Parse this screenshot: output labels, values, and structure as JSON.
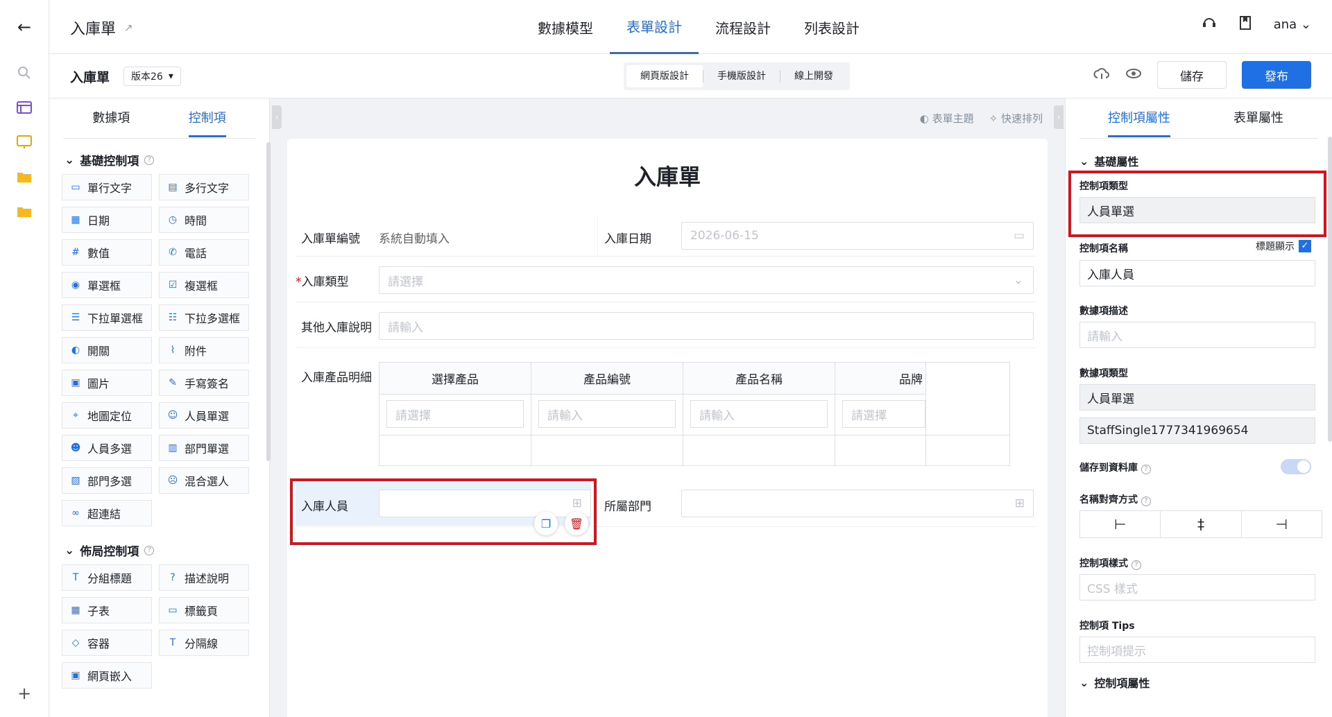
{
  "app": {
    "title": "入庫單"
  },
  "top_tabs": [
    "數據模型",
    "表單設計",
    "流程設計",
    "列表設計"
  ],
  "user": "ana",
  "sub": {
    "title": "入庫單",
    "version": "版本26",
    "modes": [
      "網頁版設計",
      "手機版設計",
      "線上開發"
    ],
    "save": "儲存",
    "publish": "發布"
  },
  "left": {
    "tabs": [
      "數據項",
      "控制項"
    ],
    "basic_title": "基礎控制項",
    "basic": [
      {
        "label": "單行文字",
        "icon": "single-line-icon"
      },
      {
        "label": "多行文字",
        "icon": "multi-line-icon"
      },
      {
        "label": "日期",
        "icon": "calendar-icon"
      },
      {
        "label": "時間",
        "icon": "clock-icon"
      },
      {
        "label": "數值",
        "icon": "number-icon"
      },
      {
        "label": "電話",
        "icon": "phone-icon"
      },
      {
        "label": "單選框",
        "icon": "radio-icon"
      },
      {
        "label": "複選框",
        "icon": "checkbox-icon"
      },
      {
        "label": "下拉單選框",
        "icon": "dropdown-single-icon"
      },
      {
        "label": "下拉多選框",
        "icon": "dropdown-multi-icon"
      },
      {
        "label": "開關",
        "icon": "switch-icon"
      },
      {
        "label": "附件",
        "icon": "paperclip-icon"
      },
      {
        "label": "圖片",
        "icon": "image-icon"
      },
      {
        "label": "手寫簽名",
        "icon": "pen-icon"
      },
      {
        "label": "地圖定位",
        "icon": "location-icon"
      },
      {
        "label": "人員單選",
        "icon": "user-icon"
      },
      {
        "label": "人員多選",
        "icon": "users-icon"
      },
      {
        "label": "部門單選",
        "icon": "department-icon"
      },
      {
        "label": "部門多選",
        "icon": "departments-icon"
      },
      {
        "label": "混合選人",
        "icon": "mixed-user-icon"
      },
      {
        "label": "超連結",
        "icon": "link-icon"
      }
    ],
    "layout_title": "佈局控制項",
    "layout": [
      {
        "label": "分組標題",
        "icon": "title-icon"
      },
      {
        "label": "描述說明",
        "icon": "help-icon"
      },
      {
        "label": "子表",
        "icon": "table-icon"
      },
      {
        "label": "標籤頁",
        "icon": "tabs-icon"
      },
      {
        "label": "容器",
        "icon": "box-icon"
      },
      {
        "label": "分隔線",
        "icon": "divider-icon"
      },
      {
        "label": "網頁嵌入",
        "icon": "embed-icon"
      }
    ]
  },
  "canvas": {
    "tools": [
      "表單主題",
      "快速排列"
    ],
    "form_title": "入庫單",
    "fields": {
      "order_no_label": "入庫單編號",
      "order_no_value": "系統自動填入",
      "date_label": "入庫日期",
      "date_value": "2026-06-15",
      "type_label": "入庫類型",
      "type_placeholder": "請選擇",
      "other_label": "其他入庫說明",
      "other_placeholder": "請輸入",
      "detail_label": "入庫產品明細",
      "staff_label": "入庫人員",
      "dept_label": "所屬部門"
    },
    "table": {
      "headers": [
        "選擇產品",
        "產品編號",
        "產品名稱",
        "品牌"
      ],
      "placeholders": [
        "請選擇",
        "請輸入",
        "請輸入",
        "請選擇"
      ]
    }
  },
  "right": {
    "tabs": [
      "控制項屬性",
      "表單屬性"
    ],
    "basic_title": "基礎屬性",
    "type_label": "控制項類型",
    "type_value": "人員單選",
    "name_label": "控制項名稱",
    "title_show": "標題顯示",
    "name_value": "入庫人員",
    "desc_label": "數據項描述",
    "desc_placeholder": "請輸入",
    "data_type_label": "數據項類型",
    "data_type_value": "人員單選",
    "data_id": "StaffSingle1777341969654",
    "save_db_label": "儲存到資料庫",
    "align_label": "名稱對齊方式",
    "style_label": "控制項樣式",
    "style_placeholder": "CSS 樣式",
    "tips_label": "控制項 Tips",
    "tips_placeholder": "控制項提示",
    "ctrl_attr_title": "控制項屬性"
  }
}
